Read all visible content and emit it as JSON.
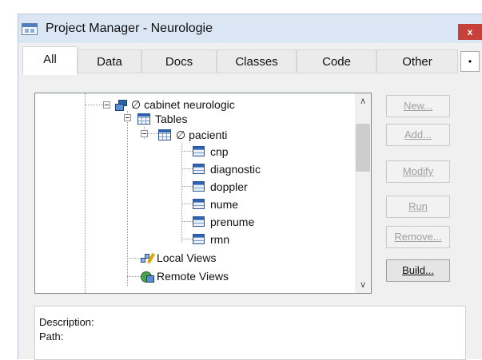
{
  "window": {
    "title": "Project Manager - Neurologie",
    "close_glyph": "x"
  },
  "tabs": [
    {
      "label": "All",
      "active": true
    },
    {
      "label": "Data",
      "active": false
    },
    {
      "label": "Docs",
      "active": false
    },
    {
      "label": "Classes",
      "active": false
    },
    {
      "label": "Code",
      "active": false
    },
    {
      "label": "Other",
      "active": false
    }
  ],
  "tab_scroll_glyph": "•",
  "tree": {
    "database": "∅ cabinet neurologic",
    "tables": "Tables",
    "table": "∅ pacienti",
    "fields": [
      "cnp",
      "diagnostic",
      "doppler",
      "nume",
      "prenume",
      "rmn"
    ],
    "local_views": "Local Views",
    "remote_views": "Remote Views",
    "icons": {
      "database": "database-icon",
      "table": "table-grid-icon",
      "field": "field-icon",
      "local_views": "local-views-icon",
      "remote_views": "remote-views-icon"
    }
  },
  "scrollbar": {
    "up_glyph": "∧",
    "down_glyph": "∨"
  },
  "buttons": {
    "new": {
      "label": "New...",
      "enabled": false
    },
    "add": {
      "label": "Add...",
      "enabled": false
    },
    "modify": {
      "label": "Modify",
      "enabled": false
    },
    "run": {
      "label": "Run",
      "enabled": false
    },
    "remove": {
      "label": "Remove...",
      "enabled": false
    },
    "build": {
      "label": "Build...",
      "enabled": true
    }
  },
  "description": {
    "description_label": "Description:",
    "path_label": "Path:"
  },
  "colors": {
    "close": "#c7403a",
    "titlebar": "#dbe6f4",
    "icon_blue": "#2f62b0"
  }
}
